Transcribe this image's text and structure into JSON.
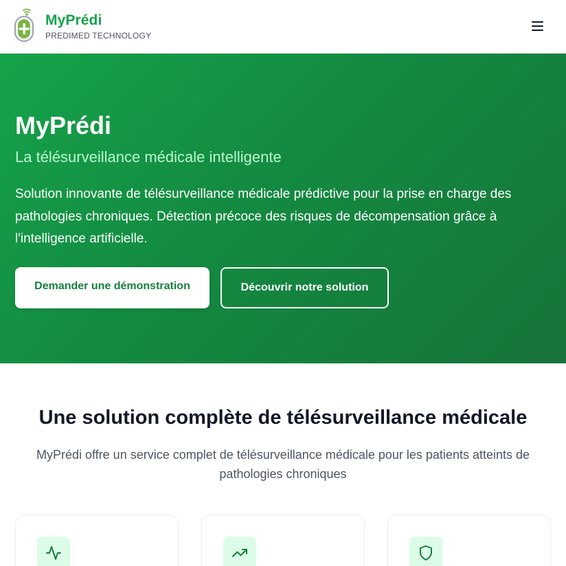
{
  "header": {
    "brand_name": "MyPrédi",
    "brand_tagline": "PREDIMED TECHNOLOGY",
    "logo_icon": "medical-cross-signal-icon",
    "menu_icon": "hamburger-menu-icon"
  },
  "hero": {
    "title": "MyPrédi",
    "subtitle": "La télésurveillance médicale intelligente",
    "description": "Solution innovante de télésurveillance médicale prédictive pour la prise en charge des pathologies chroniques. Détection précoce des risques de décompensation grâce à l'intelligence artificielle.",
    "primary_button": "Demander une démonstration",
    "secondary_button": "Découvrir notre solution",
    "colors": {
      "gradient_start": "#16a34a",
      "gradient_end": "#17733a",
      "subtitle": "#bbf7d0"
    }
  },
  "features": {
    "title": "Une solution complète de télésurveillance médicale",
    "description": "MyPrédi offre un service complet de télésurveillance médicale pour les patients atteints de pathologies chroniques",
    "cards": [
      {
        "icon": "activity-pulse-icon"
      },
      {
        "icon": "trending-up-icon"
      },
      {
        "icon": "shield-icon"
      }
    ]
  },
  "colors": {
    "brand_green": "#16a34a",
    "text_dark": "#111827",
    "text_muted": "#4b5563",
    "icon_bg": "#dcfce7"
  }
}
